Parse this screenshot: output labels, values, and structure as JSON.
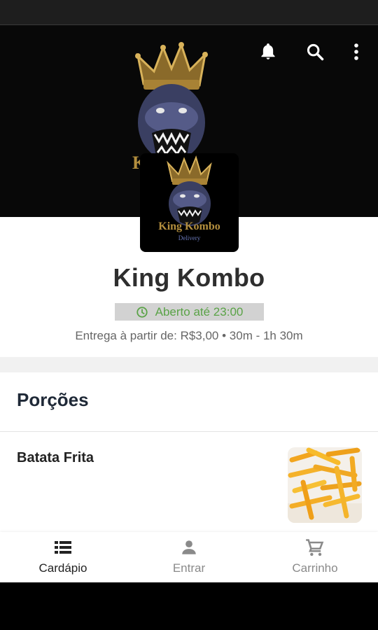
{
  "hero": {
    "logo_icon": "gorilla-king-logo",
    "logo_text_partial": "K",
    "actions": [
      {
        "name": "notification-bell",
        "icon": "bell-icon"
      },
      {
        "name": "search",
        "icon": "search-icon"
      },
      {
        "name": "more-options",
        "icon": "more-vertical-icon"
      }
    ]
  },
  "store": {
    "logo_text": "King Kombo",
    "logo_subtext": "Delivery",
    "name": "King Kombo",
    "open_status": "Aberto até 23:00",
    "delivery_info": "Entrega à partir de: R$3,00 • 30m - 1h 30m"
  },
  "menu": {
    "section_title": "Porções",
    "products": [
      {
        "name": "Batata Frita",
        "image": "french-fries"
      }
    ]
  },
  "bottom_nav": {
    "items": [
      {
        "label": "Cardápio",
        "icon": "menu-list-icon",
        "active": true
      },
      {
        "label": "Entrar",
        "icon": "person-icon",
        "active": false
      },
      {
        "label": "Carrinho",
        "icon": "cart-icon",
        "active": false
      }
    ]
  },
  "colors": {
    "open_green": "#5aa347",
    "gold": "#c9a24a",
    "text_dark": "#2e2e2e"
  }
}
